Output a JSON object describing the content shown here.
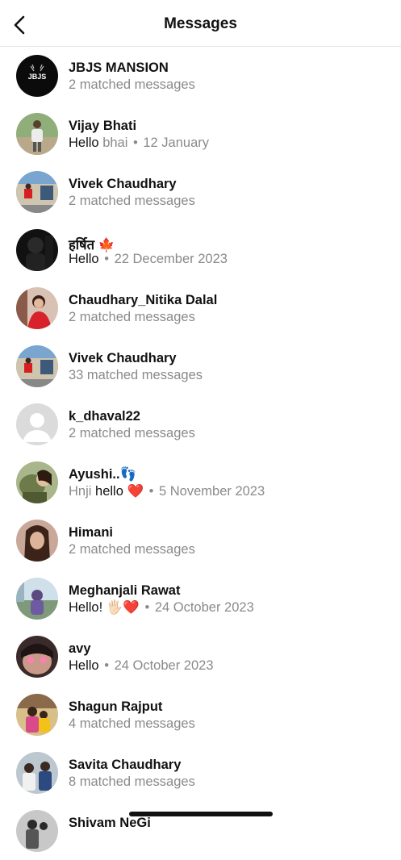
{
  "header": {
    "title": "Messages"
  },
  "rows": [
    {
      "name": "JBJS MANSION",
      "sub": "2 matched messages"
    },
    {
      "name": "Vijay Bhati",
      "msg_prefix": "Hello",
      "msg_highlight": "bhai",
      "date": "12 January"
    },
    {
      "name": "Vivek Chaudhary",
      "sub": "2 matched messages"
    },
    {
      "name": "हर्षित 🍁",
      "msg_prefix": "Hello",
      "date": "22 December 2023"
    },
    {
      "name": "Chaudhary_Nitika Dalal",
      "sub": "2 matched messages"
    },
    {
      "name": "Vivek Chaudhary",
      "sub": "33 matched messages"
    },
    {
      "name": "k_dhaval22",
      "sub": "2 matched messages"
    },
    {
      "name": "Ayushi..👣",
      "msg_prefix": "Hnji",
      "msg_highlight": "hello ❤️",
      "date": "5 November 2023"
    },
    {
      "name": "Himani",
      "sub": "2 matched messages"
    },
    {
      "name": "Meghanjali Rawat",
      "msg_prefix": "Hello! 🖐🏻❤️",
      "date": "24 October 2023"
    },
    {
      "name": "avy",
      "msg_prefix": "Hello",
      "date": "24 October 2023"
    },
    {
      "name": "Shagun Rajput",
      "sub": "4 matched messages"
    },
    {
      "name": "Savita Chaudhary",
      "sub": "8 matched messages"
    },
    {
      "name": "Shivam NeGi"
    }
  ],
  "avatar_text": {
    "jbjs": "JBJS"
  },
  "separator": "•"
}
